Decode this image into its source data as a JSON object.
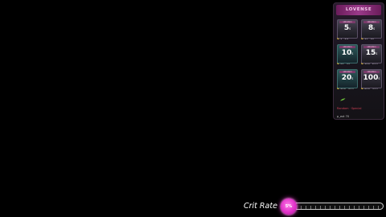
{
  "panel": {
    "brand": "LOVENSE",
    "tiles": [
      {
        "label": "vibration",
        "value": "5",
        "unit": "s",
        "range": "1~14",
        "style": "grey"
      },
      {
        "label": "vibration",
        "value": "8",
        "unit": "s",
        "range": "15~49",
        "style": "grey"
      },
      {
        "label": "vibration",
        "value": "10",
        "unit": "s",
        "range": "50~99",
        "style": "teal"
      },
      {
        "label": "vibration",
        "value": "15",
        "unit": "s",
        "range": "100~299",
        "style": "grey"
      },
      {
        "label": "vibration",
        "value": "20",
        "unit": "s",
        "range": "300~599",
        "style": "teal"
      },
      {
        "label": "vibration",
        "value": "100",
        "unit": "s",
        "range": "600~999",
        "style": "grey"
      }
    ],
    "note_red": "Random · Special",
    "note_user": "p_ext   70"
  },
  "crit": {
    "label": "Crit Rate",
    "value_text": "5%",
    "fill_fraction": 0.05
  },
  "colors": {
    "accent": "#e040d8",
    "coin": "#d4b236",
    "brand_bar": "#9a3a8a"
  }
}
